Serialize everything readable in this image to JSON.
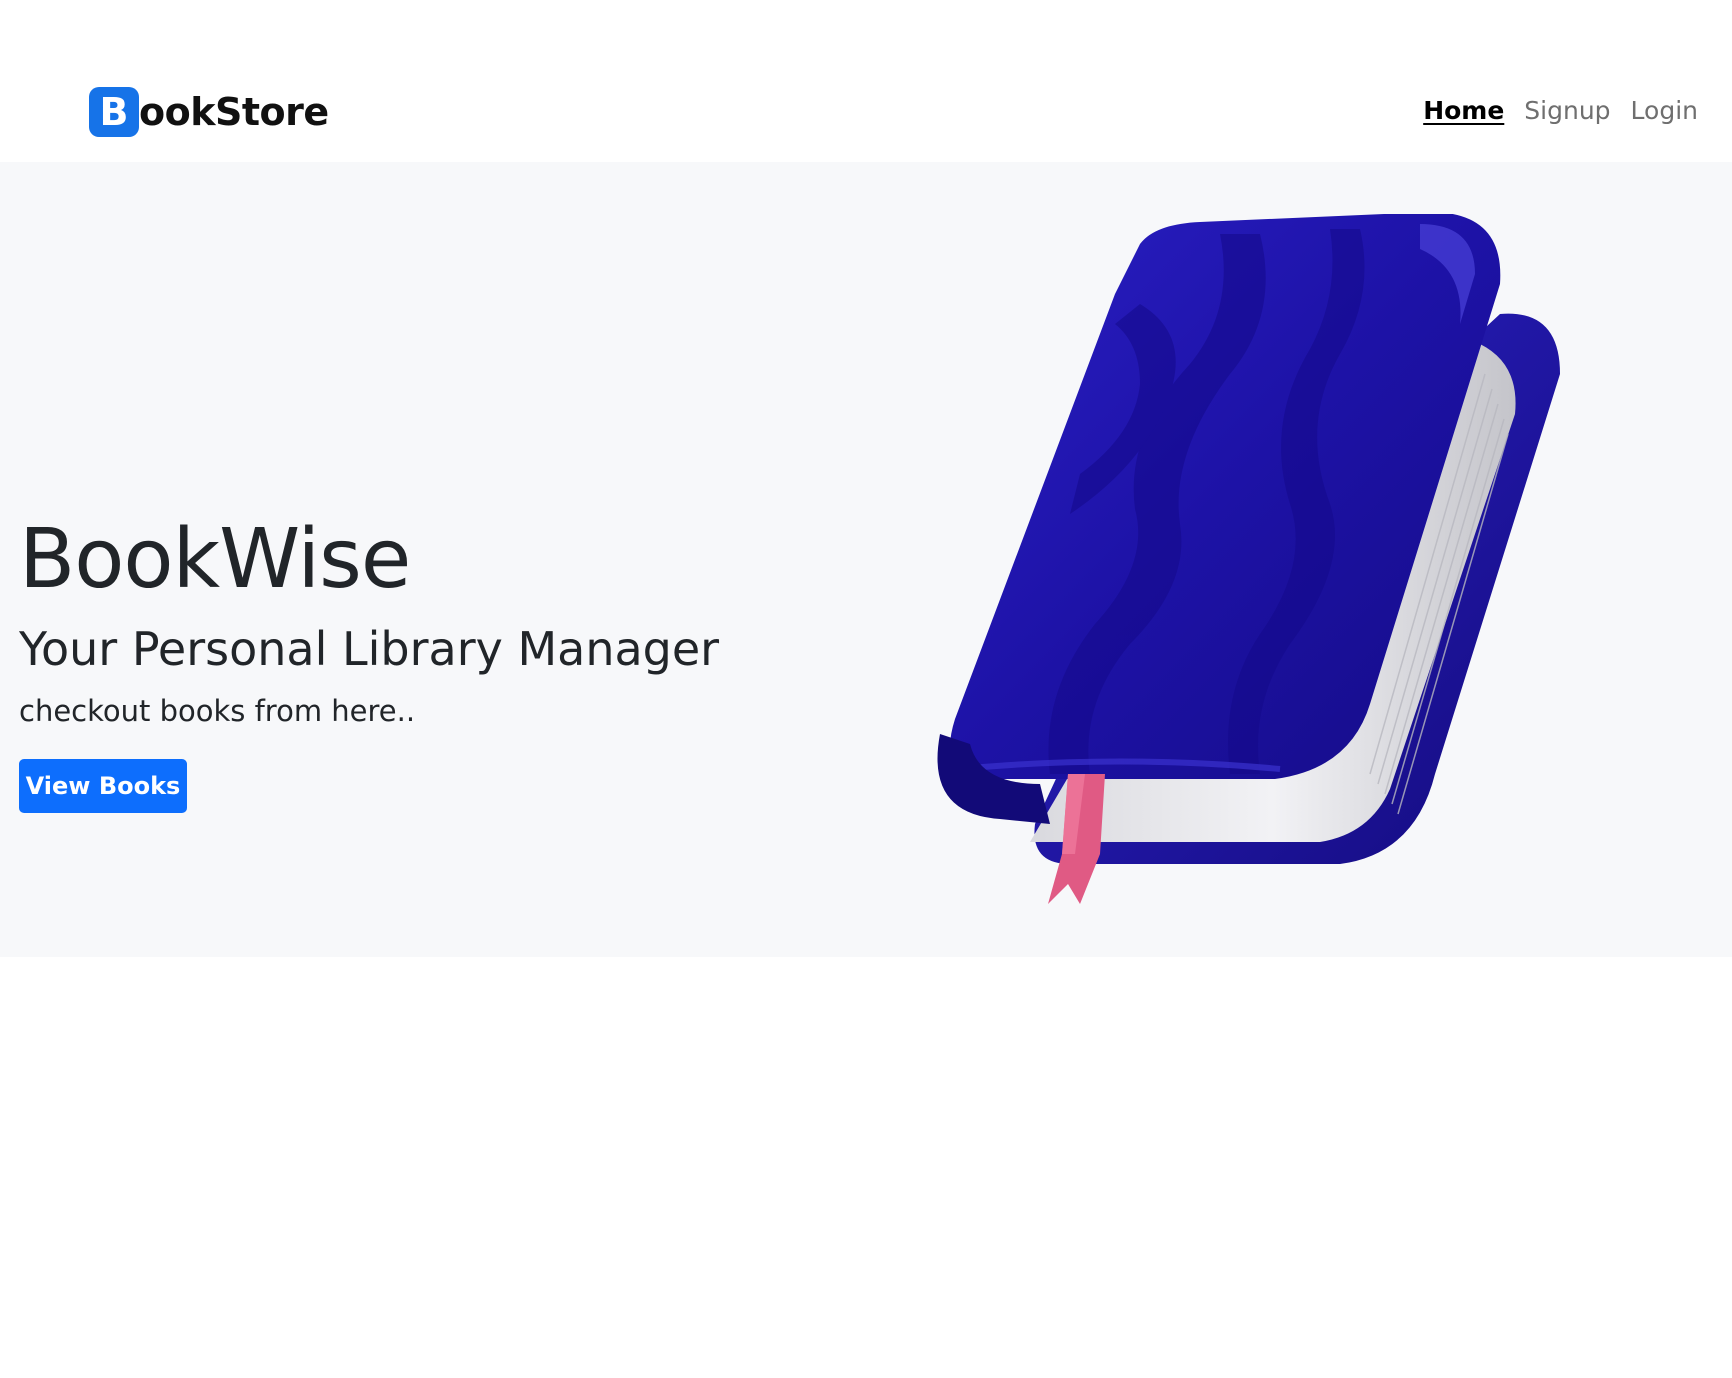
{
  "nav": {
    "brand_initial": "B",
    "brand_rest": "ookStore",
    "links": [
      {
        "label": "Home",
        "active": true
      },
      {
        "label": "Signup",
        "active": false
      },
      {
        "label": "Login",
        "active": false
      }
    ]
  },
  "hero": {
    "title": "BookWise",
    "subtitle": "Your Personal Library Manager",
    "tagline": "checkout books from here..",
    "button_label": "View Books"
  },
  "colors": {
    "brand_blue": "#1673e8",
    "button_blue": "#0d6efd",
    "hero_background": "#f7f8fa",
    "book_cover": "#1e13a8",
    "bookmark": "#e05a84"
  },
  "icons": {
    "hero_image": "blue-book-with-bookmark-icon"
  }
}
